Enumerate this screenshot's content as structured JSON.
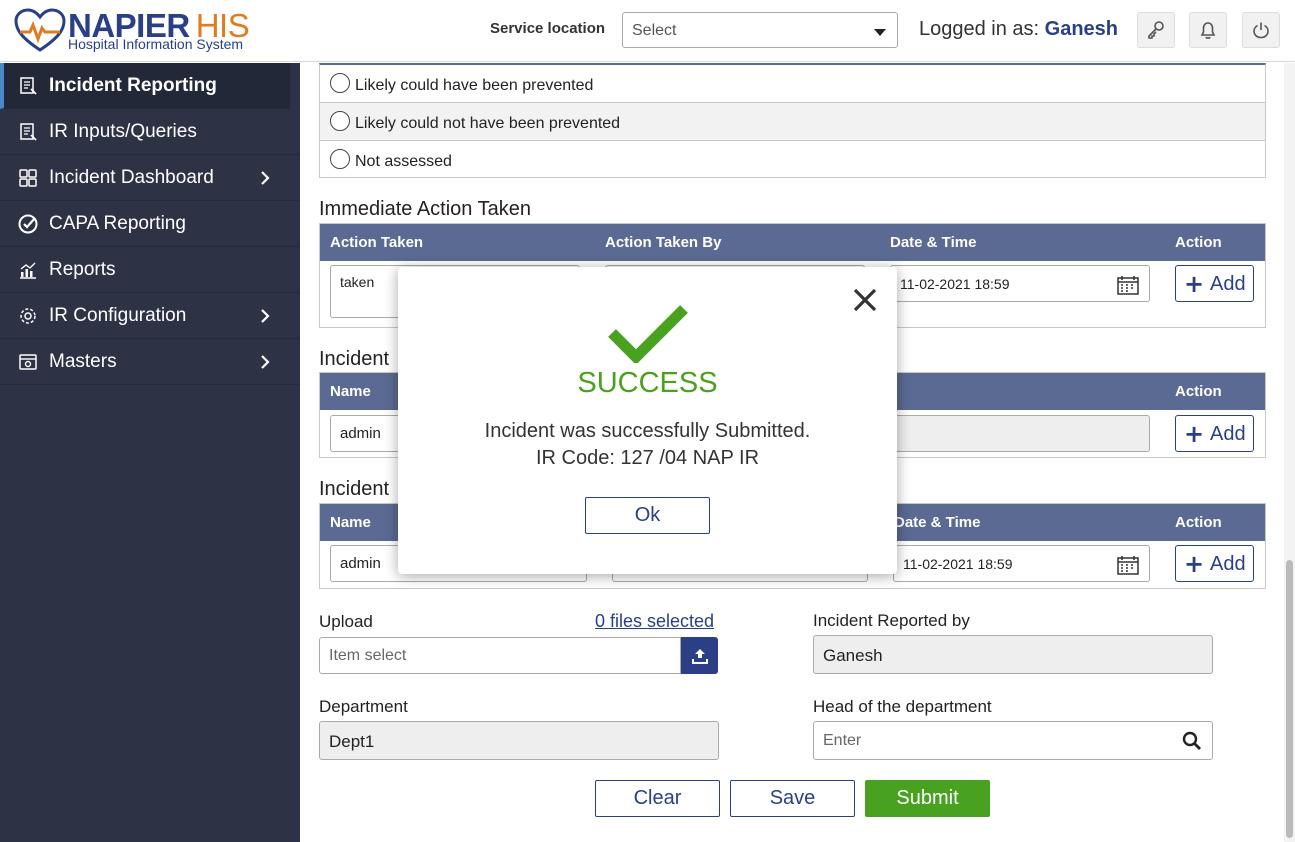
{
  "header": {
    "logo_name": "NAPIER",
    "logo_his": "HIS",
    "logo_subtitle": "Hospital Information System",
    "service_location_label": "Service location",
    "service_location_value": "Select",
    "logged_in_prefix": "Logged in as: ",
    "logged_in_user": "Ganesh",
    "icons": [
      "key-icon",
      "bell-icon",
      "power-icon"
    ]
  },
  "sidebar": {
    "items": [
      {
        "label": "Incident Reporting",
        "icon": "report-icon",
        "active": true
      },
      {
        "label": "IR Inputs/Queries",
        "icon": "report-icon"
      },
      {
        "label": "Incident Dashboard",
        "icon": "dashboard-icon",
        "has_children": true
      },
      {
        "label": "CAPA Reporting",
        "icon": "check-circle-icon"
      },
      {
        "label": "Reports",
        "icon": "chart-icon"
      },
      {
        "label": "IR Configuration",
        "icon": "gear-icon",
        "has_children": true
      },
      {
        "label": "Masters",
        "icon": "masters-icon",
        "has_children": true
      }
    ]
  },
  "preventability": {
    "options": [
      "Likely could have been prevented",
      "Likely could not have been prevented",
      "Not assessed"
    ]
  },
  "immediate_action": {
    "title": "Immediate Action Taken",
    "columns": [
      "Action Taken",
      "Action Taken By",
      "Date & Time",
      "Action"
    ],
    "row": {
      "action_taken": "taken",
      "date_time": "11-02-2021 18:59"
    },
    "add_label": "Add"
  },
  "incident_section_2": {
    "title": "Incident",
    "columns": [
      "Name",
      "Action"
    ],
    "row": {
      "name": "admin"
    },
    "add_label": "Add"
  },
  "incident_section_3": {
    "title": "Incident",
    "columns": [
      "Name",
      "Date & Time",
      "Action"
    ],
    "row": {
      "name": "admin",
      "date_time": "11-02-2021 18:59"
    },
    "add_label": "Add"
  },
  "form": {
    "upload_label": "Upload",
    "files_selected": "0 files selected",
    "upload_placeholder": "Item select",
    "reported_by_label": "Incident Reported by",
    "reported_by_value": "Ganesh",
    "department_label": "Department",
    "department_value": "Dept1",
    "head_label": "Head of the department",
    "head_placeholder": "Enter"
  },
  "buttons": {
    "clear": "Clear",
    "save": "Save",
    "submit": "Submit"
  },
  "modal": {
    "title": "SUCCESS",
    "message": "Incident was successfully Submitted.",
    "ir_code": "IR Code: 127 /04 NAP IR",
    "ok": "Ok"
  },
  "colors": {
    "brand_blue": "#2a3f86",
    "brand_orange": "#e07b22",
    "sidebar_bg": "#2d3345",
    "grid_header": "#5b6a93",
    "success_green": "#48a21f"
  }
}
